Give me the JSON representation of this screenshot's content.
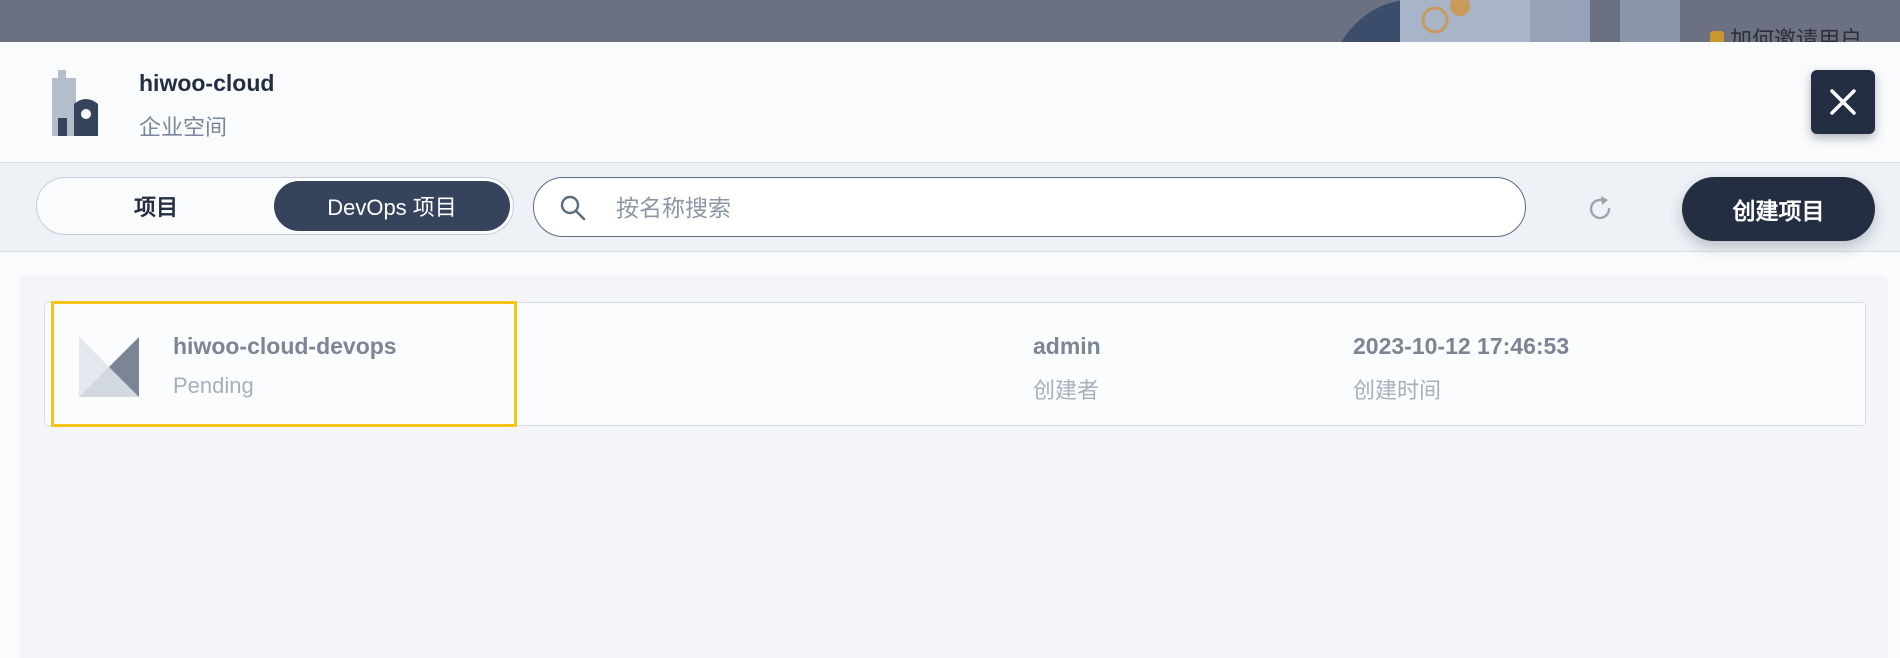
{
  "backdrop": {
    "tip_text": "加何邀请用户"
  },
  "workspace": {
    "name": "hiwoo-cloud",
    "type_label": "企业空间"
  },
  "toolbar": {
    "tabs": [
      {
        "label": "项目",
        "active": false
      },
      {
        "label": "DevOps 项目",
        "active": true
      }
    ],
    "search_placeholder": "按名称搜索",
    "search_value": "",
    "create_label": "创建项目"
  },
  "projects": [
    {
      "name": "hiwoo-cloud-devops",
      "status": "Pending",
      "creator": "admin",
      "creator_label": "创建者",
      "created_time": "2023-10-12 17:46:53",
      "created_time_label": "创建时间"
    }
  ],
  "colors": {
    "primary_dark": "#242e42",
    "tab_active": "#36435c",
    "highlight": "#f5c518",
    "muted_text": "#79879c"
  },
  "icons": {
    "workspace": "building-icon",
    "close": "close-icon",
    "search": "search-icon",
    "refresh": "refresh-icon",
    "project": "devops-project-icon"
  }
}
